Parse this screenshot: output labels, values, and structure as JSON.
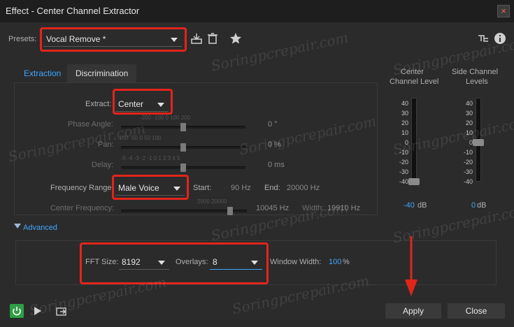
{
  "window": {
    "title": "Effect - Center Channel Extractor",
    "close_glyph": "×"
  },
  "presets": {
    "label": "Presets:",
    "value": "Vocal Remove *"
  },
  "tabs": [
    {
      "label": "Extraction"
    },
    {
      "label": "Discrimination"
    }
  ],
  "extract": {
    "label": "Extract:",
    "value": "Center"
  },
  "phase_angle": {
    "label": "Phase Angle:",
    "ticks": "-200   -100     0     100    200",
    "value": "0 °"
  },
  "pan": {
    "label": "Pan:",
    "ticks": "100    -50      0      50    100",
    "value": "0 %"
  },
  "delay": {
    "label": "Delay:",
    "ticks": "-5 -4 -3 -2 -1  0  1  2  3  4  5",
    "value": "0 ms"
  },
  "frequency_range": {
    "label": "Frequency Range:",
    "value": "Male Voice",
    "start_label": "Start:",
    "start_value": "90 Hz",
    "end_label": "End:",
    "end_value": "20000 Hz"
  },
  "center_frequency": {
    "label": "Center Frequency:",
    "ticks": "2000  20000",
    "value": "10045 Hz",
    "width_label": "Width:",
    "width_value": "19910 Hz"
  },
  "meters": {
    "center": {
      "title_line1": "Center",
      "title_line2": "Channel Level",
      "value": "-40",
      "unit": "dB",
      "level_db": -40
    },
    "side": {
      "title_line1": "Side Channel",
      "title_line2": "Levels",
      "value": "0",
      "unit": "dB",
      "level_db": 0
    },
    "scale": [
      "40",
      "30",
      "20",
      "10",
      "0",
      "-10",
      "-20",
      "-30",
      "-40"
    ]
  },
  "advanced": {
    "label": "Advanced",
    "fft_label": "FFT Size:",
    "fft_value": "8192",
    "overlays_label": "Overlays:",
    "overlays_value": "8",
    "window_width_label": "Window Width:",
    "window_width_value": "100",
    "window_width_unit": "%"
  },
  "buttons": {
    "apply": "Apply",
    "close": "Close"
  },
  "watermark": "Soringpcrepair.com",
  "colors": {
    "accent": "#3ea6ff",
    "highlight": "#e1251b",
    "power": "#2f9e44"
  }
}
